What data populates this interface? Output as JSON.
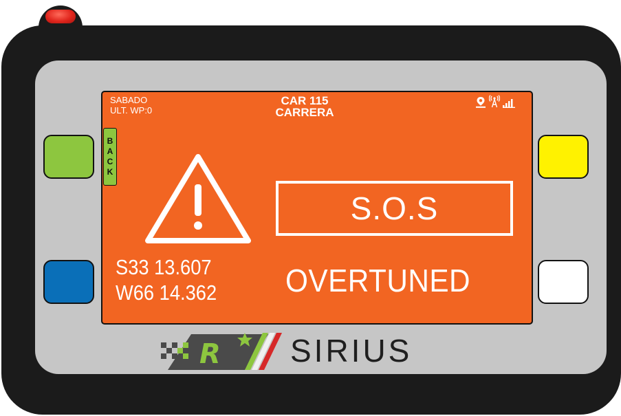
{
  "device": {
    "brand_name": "SIRIUS",
    "logo_letter": "R",
    "colors": {
      "screen": "#f26522",
      "button_green": "#8dc63f",
      "button_blue": "#0a6fb8",
      "button_yellow": "#fff200",
      "button_white": "#ffffff",
      "power_button": "#e0251c"
    }
  },
  "status_bar": {
    "day": "SABADO",
    "last_waypoint": "ULT. WP:0",
    "car": "CAR 115",
    "mode": "CARRERA",
    "icons": [
      "gps-pin-icon",
      "antenna-icon",
      "signal-bars-icon"
    ]
  },
  "back_button": {
    "letters": [
      "B",
      "A",
      "C",
      "K"
    ]
  },
  "alert": {
    "icon": "warning-triangle-icon",
    "title": "S.O.S",
    "message": "OVERTUNED"
  },
  "position": {
    "latitude": "S33 13.607",
    "longitude": "W66 14.362"
  }
}
